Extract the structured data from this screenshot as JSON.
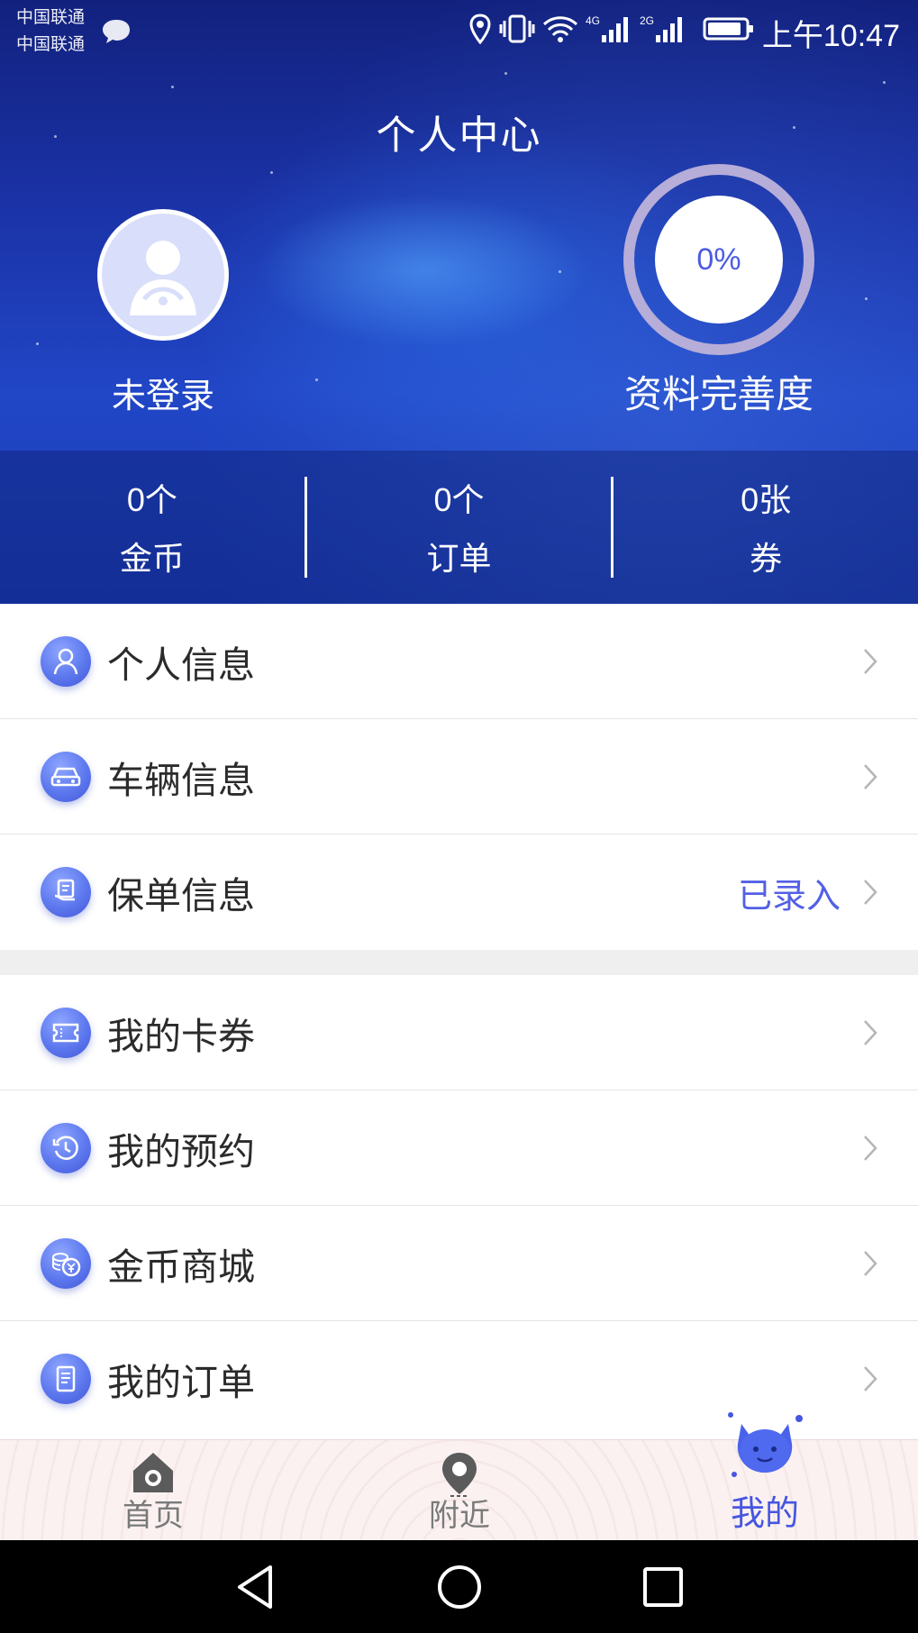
{
  "status_bar": {
    "carrier1": "中国联通",
    "carrier2": "中国联通",
    "network1": "4G",
    "network2": "2G",
    "time": "上午10:47",
    "icons": [
      "message-icon",
      "location-icon",
      "vibrate-icon",
      "wifi-icon",
      "signal-4g-icon",
      "signal-2g-icon",
      "battery-icon"
    ]
  },
  "header": {
    "title": "个人中心",
    "login_status": "未登录",
    "completion_value": "0%",
    "completion_label": "资料完善度"
  },
  "stats": [
    {
      "value": "0个",
      "label": "金币"
    },
    {
      "value": "0个",
      "label": "订单"
    },
    {
      "value": "0张",
      "label": "券"
    }
  ],
  "menu": {
    "group1": [
      {
        "label": "个人信息",
        "icon": "person-icon",
        "value": ""
      },
      {
        "label": "车辆信息",
        "icon": "car-icon",
        "value": ""
      },
      {
        "label": "保单信息",
        "icon": "policy-icon",
        "value": "已录入"
      }
    ],
    "group2": [
      {
        "label": "我的卡券",
        "icon": "ticket-icon"
      },
      {
        "label": "我的预约",
        "icon": "clock-icon"
      },
      {
        "label": "金币商城",
        "icon": "coins-icon"
      },
      {
        "label": "我的订单",
        "icon": "order-icon"
      }
    ]
  },
  "tabs": [
    {
      "label": "首页",
      "icon": "home-icon",
      "active": false
    },
    {
      "label": "附近",
      "icon": "location-pin-icon",
      "active": false
    },
    {
      "label": "我的",
      "icon": "mascot-icon",
      "active": true
    }
  ],
  "colors": {
    "accent": "#4656e0",
    "header_blue": "#1b33a8",
    "icon_blue": "#5d78ee"
  }
}
